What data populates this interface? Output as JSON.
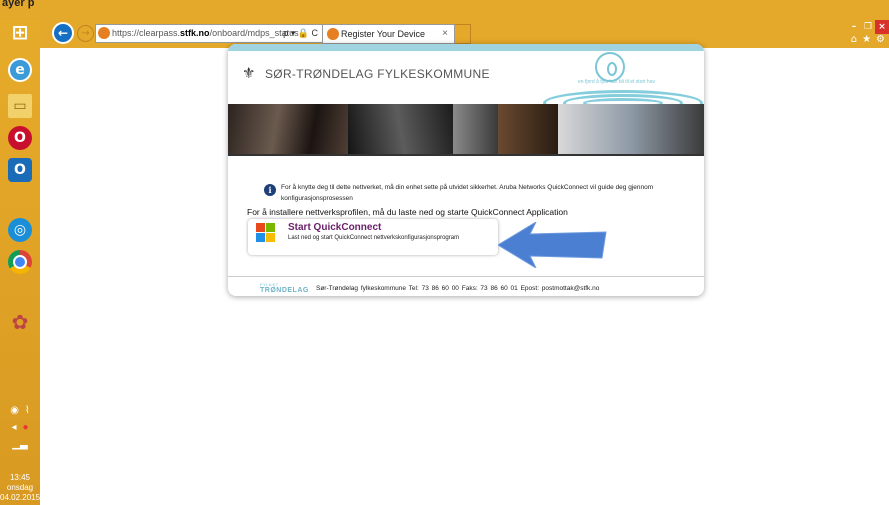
{
  "window": {
    "clipped_title": "ayer p"
  },
  "taskbar": {
    "clock_time": "13:45",
    "clock_day": "onsdag",
    "clock_date": "04.02.2015"
  },
  "browser": {
    "url_prefix": "https://clearpass.",
    "url_host": "stfk.no",
    "url_path": "/onboard/mdps_status",
    "address_tools": "ρ ▾ 🔒 C",
    "tab_title": "Register Your Device",
    "tab_close": "×"
  },
  "page": {
    "org_name": "SØR-TRØNDELAG FYLKESKOMMUNE",
    "tagline": "en fjord å fjos kan bli til et stort hav",
    "info_text": "For å knytte deg til dette nettverket, må din enhet sette på utvidet sikkerhet. Aruba Networks QuickConnect vil guide deg gjennom konfigurasjonsprosessen",
    "install_text": "For å installere nettverksprofilen, må du laste ned og starte QuickConnect Application",
    "quickconnect": {
      "title": "Start QuickConnect",
      "subtitle": "Last ned og start QuickConnect nettverkskonfigurasjonsprogram"
    },
    "footer": {
      "logo_small": "FYLKET",
      "logo_name": "TRØNDELAG",
      "text": "Sør-Trøndelag fylkeskommune   Tel: 73 86 60 00   Faks: 73 86 60 01   Epost: postmottak@stfk.no"
    },
    "colors": {
      "accent": "#9fd3e0",
      "title_purple": "#6a1f6a",
      "arrow_blue": "#4a7fd1"
    }
  }
}
